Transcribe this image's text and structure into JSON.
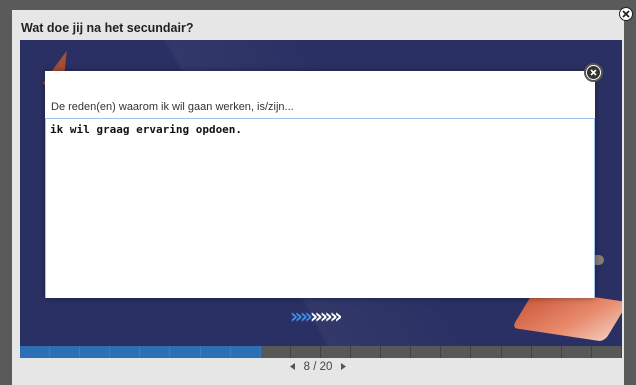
{
  "window": {
    "title": "Wat doe jij na het secundair?"
  },
  "dialog": {
    "question": "De reden(en) waarom ik wil gaan werken, is/zijn...",
    "answer_value": "ik wil graag ervaring opdoen."
  },
  "navigation": {
    "arrows_blue": "»»",
    "arrows_white": "»»»",
    "pager_text": "8 / 20",
    "prev_icon": "previous-triangle-icon",
    "next_icon": "next-triangle-icon"
  },
  "progress": {
    "current": 8,
    "total": 20
  },
  "colors": {
    "stage_bg": "#2a3063",
    "accent_blue": "#2d6fb4",
    "arrow_blue": "#3d8ee8"
  }
}
